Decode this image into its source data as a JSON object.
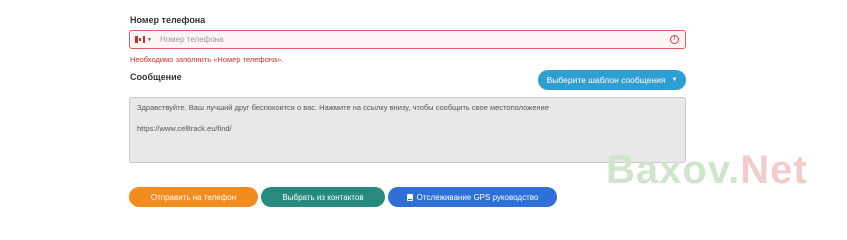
{
  "phone": {
    "label": "Номер телефона",
    "placeholder": "Номер телефона",
    "value": "",
    "country": "Canada",
    "error_icon": "alert-circle-icon",
    "error_message": "Необходимо заполнить «Номер телефона»."
  },
  "message": {
    "label": "Сообщение",
    "template_button": "Выберите шаблон сообщения",
    "text_line1": "Здравствуйте. Ваш лучший друг беспокоится о вас. Нажмите на ссылку внизу, чтобы сообщить свое местоположение",
    "text_line2": "https://www.celltrack.eu/find/"
  },
  "actions": {
    "send": "Отправить на телефон",
    "contacts": "Выбрать из контактов",
    "gps": "Отслеживание GPS руководство",
    "gps_icon": "book-icon"
  },
  "watermark": {
    "part1": "Baxov.",
    "part2": "Net"
  },
  "colors": {
    "error": "#d0394c",
    "template_button": "#2f9fd1",
    "send_button": "#f28c1e",
    "contacts_button": "#268a7f",
    "gps_button": "#2f6fd8"
  }
}
